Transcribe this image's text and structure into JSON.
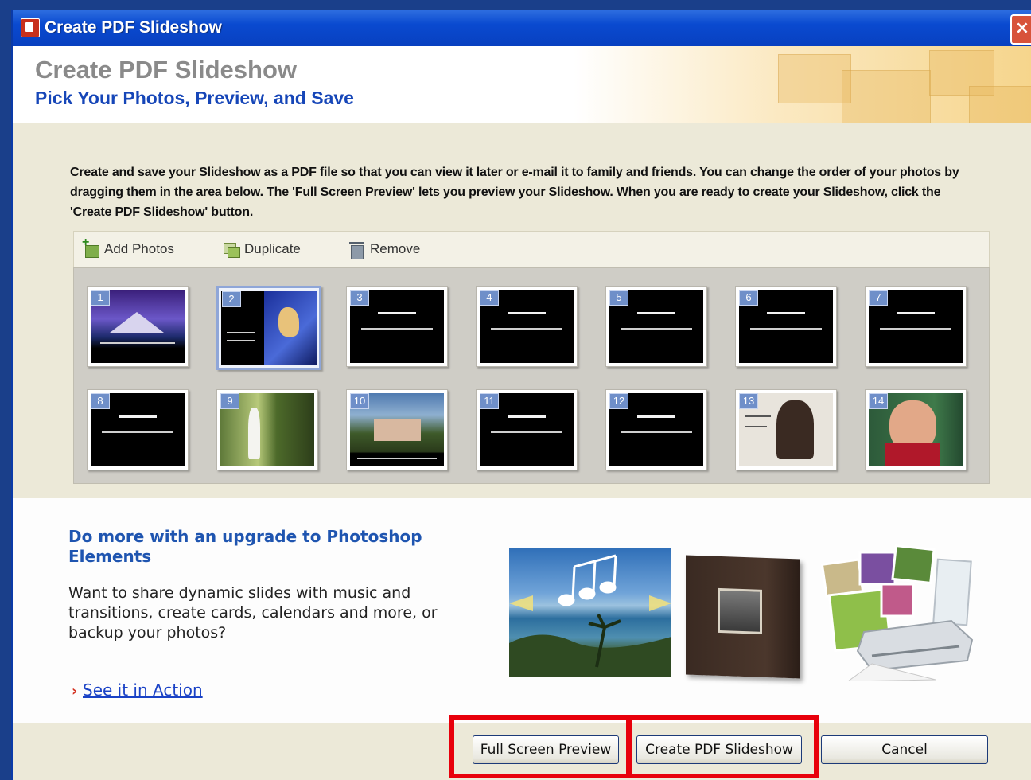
{
  "window": {
    "title": "Create PDF Slideshow",
    "close_glyph": "×"
  },
  "header": {
    "title": "Create PDF Slideshow",
    "subtitle": "Pick Your Photos, Preview, and Save"
  },
  "description": "Create and save your Slideshow as a PDF file so that you can view it later or e-mail it to family and friends. You can change the order of your photos by dragging them in the area below. The 'Full Screen Preview' lets you preview your Slideshow. When you are ready to create your Slideshow, click the 'Create PDF Slideshow' button.",
  "toolbar": {
    "add_label": "Add Photos",
    "duplicate_label": "Duplicate",
    "remove_label": "Remove"
  },
  "slides": [
    {
      "number": "1",
      "selected": false,
      "style": "mountain"
    },
    {
      "number": "2",
      "selected": true,
      "style": "hand"
    },
    {
      "number": "3",
      "selected": false,
      "style": "text"
    },
    {
      "number": "4",
      "selected": false,
      "style": "text"
    },
    {
      "number": "5",
      "selected": false,
      "style": "text"
    },
    {
      "number": "6",
      "selected": false,
      "style": "text"
    },
    {
      "number": "7",
      "selected": false,
      "style": "text"
    },
    {
      "number": "8",
      "selected": false,
      "style": "text"
    },
    {
      "number": "9",
      "selected": false,
      "style": "garden"
    },
    {
      "number": "10",
      "selected": false,
      "style": "house"
    },
    {
      "number": "11",
      "selected": false,
      "style": "text"
    },
    {
      "number": "12",
      "selected": false,
      "style": "text"
    },
    {
      "number": "13",
      "selected": false,
      "style": "woman"
    },
    {
      "number": "14",
      "selected": false,
      "style": "laugh"
    }
  ],
  "upgrade": {
    "title": "Do more with an upgrade to Photoshop Elements",
    "body": "Want to share dynamic slides with music and transitions, create cards, calendars and more, or backup your photos?",
    "link_arrow": "›",
    "link_label": "See it in Action"
  },
  "buttons": {
    "preview_label": "Full Screen Preview",
    "create_label": "Create PDF Slideshow",
    "cancel_label": "Cancel"
  },
  "colors": {
    "title_bar": "#0a4ad0",
    "subtitle": "#1646b8",
    "highlight": "#e8000b",
    "link": "#1a42c6"
  }
}
